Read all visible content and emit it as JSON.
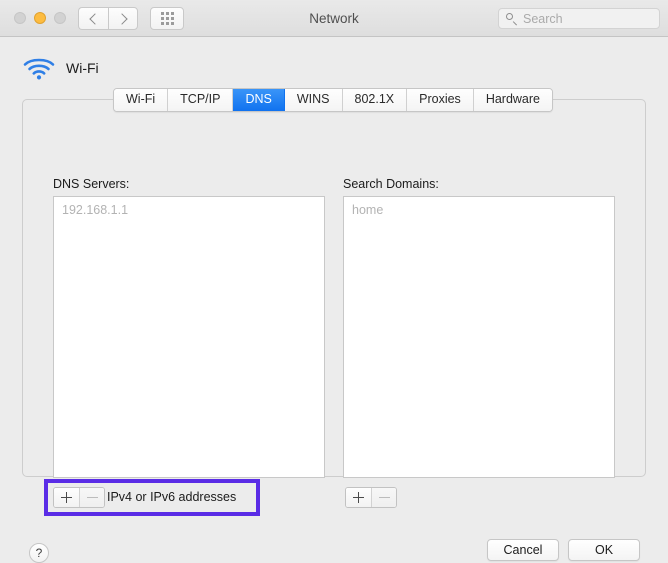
{
  "window": {
    "title": "Network",
    "traffic_lights": [
      "close",
      "minimize",
      "zoom"
    ]
  },
  "toolbar": {
    "back_icon": "chevron-left-icon",
    "forward_icon": "chevron-right-icon",
    "show_all_icon": "grid-dots-icon",
    "search": {
      "placeholder": "Search",
      "icon": "search-icon",
      "value": ""
    }
  },
  "interface": {
    "name": "Wi-Fi",
    "icon": "wifi-icon",
    "icon_color": "#2f7fe6"
  },
  "tabs": [
    {
      "label": "Wi-Fi",
      "selected": false
    },
    {
      "label": "TCP/IP",
      "selected": false
    },
    {
      "label": "DNS",
      "selected": true
    },
    {
      "label": "WINS",
      "selected": false
    },
    {
      "label": "802.1X",
      "selected": false
    },
    {
      "label": "Proxies",
      "selected": false
    },
    {
      "label": "Hardware",
      "selected": false
    }
  ],
  "dns_servers": {
    "label": "DNS Servers:",
    "entries": [
      "192.168.1.1"
    ],
    "entry_style": "placeholder-grey",
    "add_icon": "plus-icon",
    "remove_icon": "minus-icon",
    "hint": "IPv4 or IPv6 addresses"
  },
  "search_domains": {
    "label": "Search Domains:",
    "entries": [
      "home"
    ],
    "entry_style": "placeholder-grey",
    "add_icon": "plus-icon",
    "remove_icon": "minus-icon"
  },
  "annotation": {
    "color": "#5a2ce6",
    "target": "dns-servers-add-remove-controls"
  },
  "footer": {
    "help_label": "?",
    "cancel_label": "Cancel",
    "ok_label": "OK"
  }
}
